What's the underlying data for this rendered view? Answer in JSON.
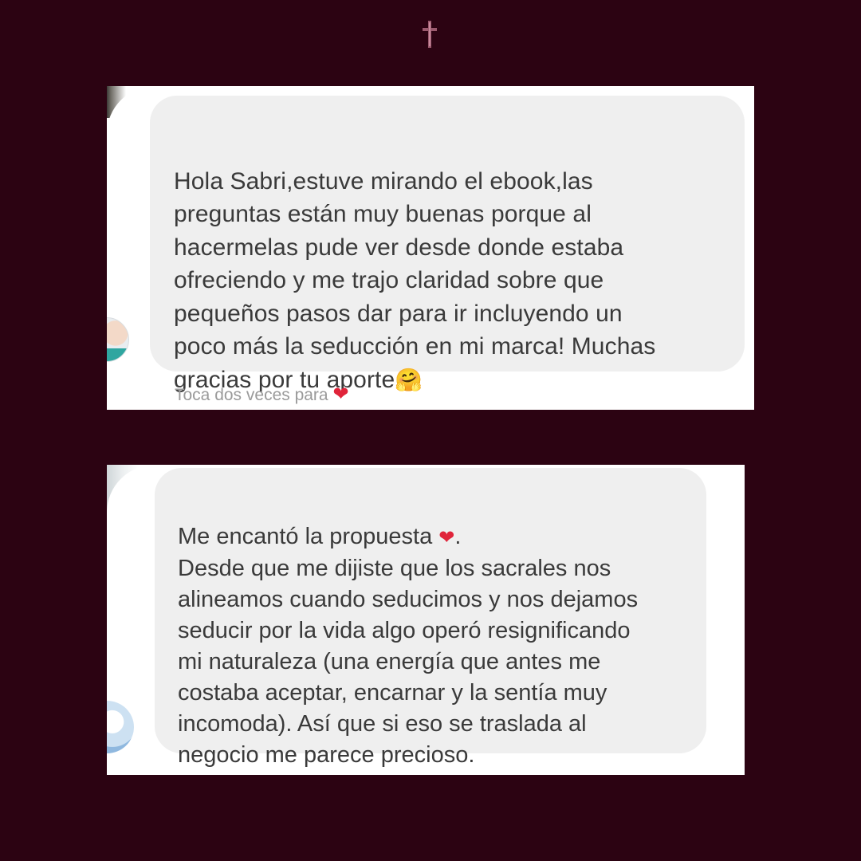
{
  "header": {
    "icon": "cross-icon"
  },
  "messages": [
    {
      "text": "Hola Sabri,estuve mirando el ebook,las\npreguntas están muy buenas porque al\nhacermelas pude ver desde donde estaba\nofreciendo y me trajo claridad sobre que\npequeños pasos dar para ir incluyendo un\npoco más la seducción en mi marca! Muchas\ngracias por tu aporte",
      "emoji": "🤗",
      "hint": "Toca dos veces para",
      "hint_icon": "❤"
    },
    {
      "text_before": "Me encantó la propuesta ",
      "heart": "❤",
      "text_after": ".\nDesde que me dijiste que los sacrales nos\nalineamos cuando seducimos y nos dejamos\nseducir por la vida algo operó resignificando\nmi naturaleza (una energía que antes me\ncostaba aceptar, encarnar y la sentía muy\nincomoda). Así que si eso se traslada al\nnegocio me parece precioso."
    }
  ],
  "colors": {
    "background": "#2c0312",
    "bubble": "#efefef",
    "heart": "#e0243a",
    "cross": "#9b5a6e"
  }
}
